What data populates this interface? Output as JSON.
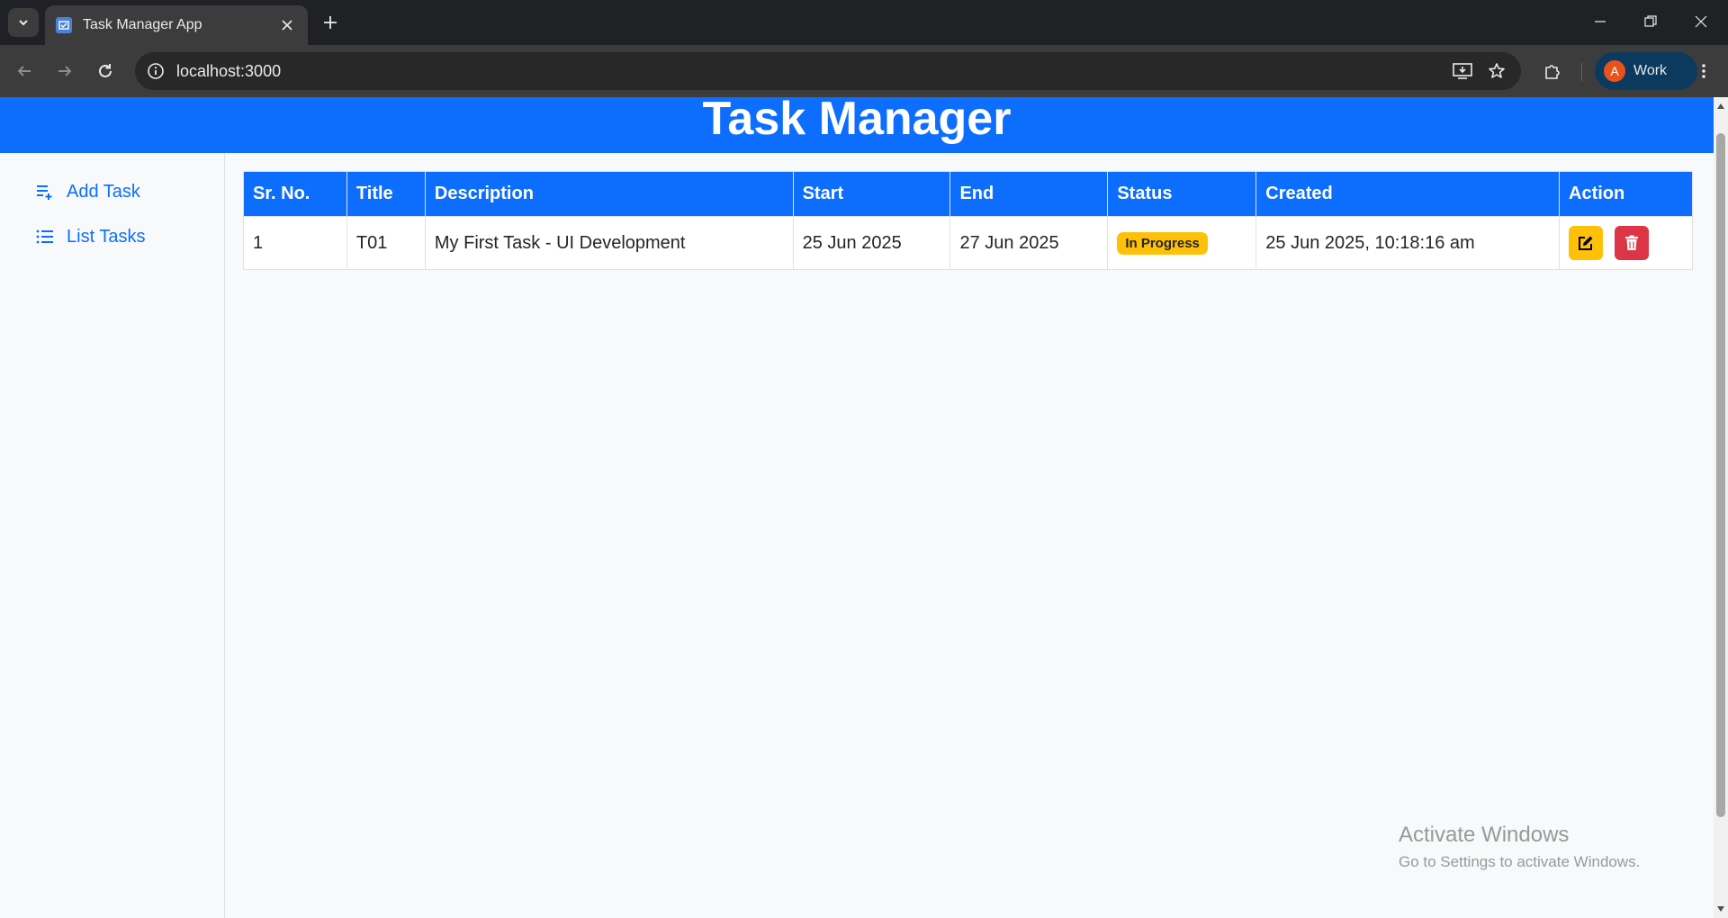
{
  "browser": {
    "tab_title": "Task Manager App",
    "url": "localhost:3000",
    "profile_initial": "A",
    "profile_label": "Work"
  },
  "header": {
    "title": "Task Manager"
  },
  "sidebar": {
    "items": [
      {
        "label": "Add Task",
        "icon": "add-list-icon"
      },
      {
        "label": "List Tasks",
        "icon": "list-icon"
      }
    ]
  },
  "table": {
    "columns": [
      "Sr. No.",
      "Title",
      "Description",
      "Start",
      "End",
      "Status",
      "Created",
      "Action"
    ],
    "rows": [
      {
        "sr_no": "1",
        "title": "T01",
        "description": "My First Task - UI Development",
        "start": "25 Jun 2025",
        "end": "27 Jun 2025",
        "status": "In Progress",
        "created": "25 Jun 2025, 10:18:16 am"
      }
    ]
  },
  "colors": {
    "primary": "#0d6efd",
    "warning": "#ffc107",
    "danger": "#dc3545"
  },
  "watermark": {
    "title": "Activate Windows",
    "subtitle": "Go to Settings to activate Windows."
  }
}
